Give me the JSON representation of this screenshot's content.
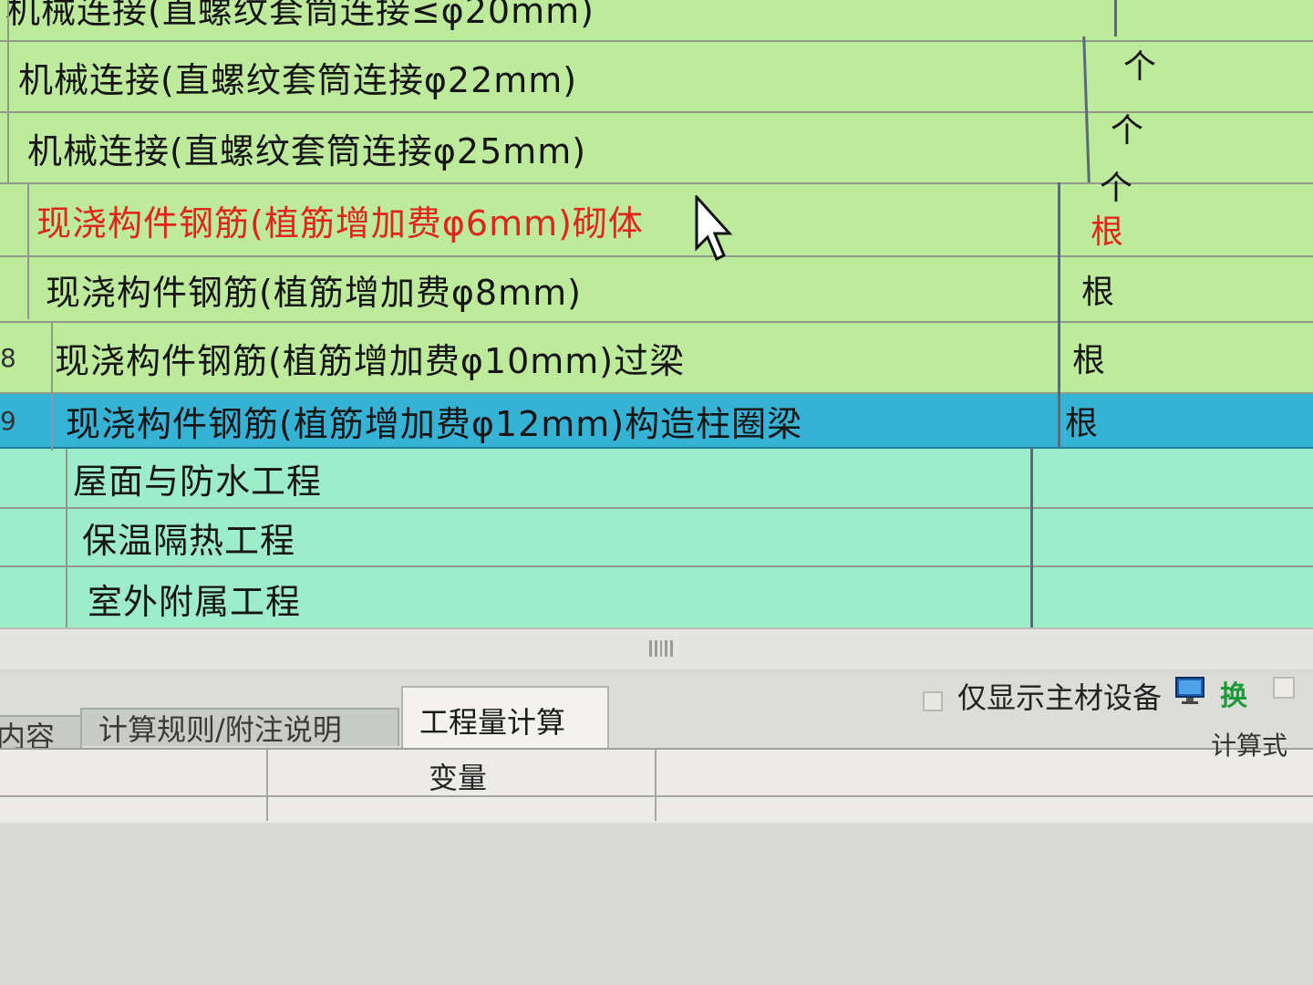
{
  "grid": {
    "rows": [
      {
        "num": "",
        "name": "机械连接(直螺纹套筒连接≤φ20mm)",
        "unit": "",
        "style": "green",
        "color": "normal"
      },
      {
        "num": "",
        "name": "机械连接(直螺纹套筒连接φ22mm)",
        "unit": "个",
        "style": "green",
        "color": "normal"
      },
      {
        "num": "",
        "name": "机械连接(直螺纹套筒连接φ25mm)",
        "unit": "个",
        "style": "green",
        "color": "normal"
      },
      {
        "num": "",
        "name": "现浇构件钢筋(植筋增加费φ6mm)砌体",
        "unit": "个",
        "style": "green",
        "color": "red"
      },
      {
        "num": "",
        "name": "现浇构件钢筋(植筋增加费φ8mm)",
        "unit": "根",
        "style": "green",
        "color": "normal"
      },
      {
        "num": "8",
        "name": "现浇构件钢筋(植筋增加费φ10mm)过梁",
        "unit": "根",
        "style": "green",
        "color": "normal"
      },
      {
        "num": "9",
        "name": "现浇构件钢筋(植筋增加费φ12mm)构造柱圈梁",
        "unit": "根",
        "style": "selected",
        "color": "normal"
      },
      {
        "num": "",
        "name": "屋面与防水工程",
        "unit": "",
        "style": "teal",
        "color": "normal"
      },
      {
        "num": "",
        "name": "保温隔热工程",
        "unit": "",
        "style": "teal",
        "color": "normal"
      },
      {
        "num": "",
        "name": "室外附属工程",
        "unit": "",
        "style": "teal",
        "color": "normal"
      }
    ],
    "red_unit": "根"
  },
  "bottom_panel": {
    "tabs": [
      "内容",
      "计算规则/附注说明",
      "工程量计算"
    ],
    "active_tab": "工程量计算",
    "option_label": "仅显示主材设备",
    "swap_icon_label": "换",
    "columns": {
      "variable": "变量",
      "formula": "计算式"
    }
  },
  "icons": {
    "monitor": "monitor-icon",
    "swap": "swap-icon",
    "cursor": "mouse-pointer-icon"
  },
  "colors": {
    "row_green": "#bdea9b",
    "row_teal": "#9deccb",
    "row_selected": "#36b2d5",
    "red_text": "#e0261b"
  }
}
